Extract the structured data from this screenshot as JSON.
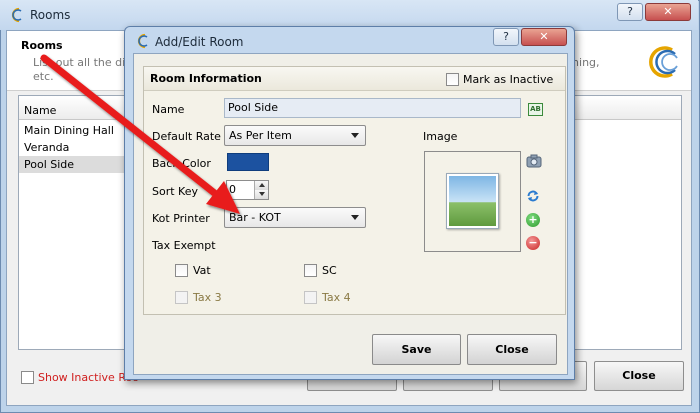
{
  "rooms_window": {
    "title": "Rooms",
    "heading": "Rooms",
    "description_line1": "List out all the dini",
    "description_line2": "etc.",
    "description_right": "ining,",
    "grid": {
      "column_name": "Name",
      "rows": [
        "Main Dining Hall",
        "Veranda",
        "Pool Side"
      ]
    },
    "show_inactive_label": "Show Inactive Roo",
    "close_label": "Close",
    "help_glyph": "?",
    "close_glyph": "✕"
  },
  "dialog": {
    "title": "Add/Edit Room",
    "help_glyph": "?",
    "close_glyph": "✕",
    "section_title": "Room Information",
    "mark_inactive_label": "Mark as Inactive",
    "name_label": "Name",
    "name_value": "Pool Side",
    "default_rate_label": "Default Rate",
    "default_rate_value": "As Per Item",
    "back_color_label": "Back Color",
    "sort_key_label": "Sort Key",
    "sort_key_value": "0",
    "kot_printer_label": "Kot Printer",
    "kot_printer_value": "Bar - KOT",
    "tax_exempt_label": "Tax Exempt",
    "tax_options": [
      {
        "label": "Vat",
        "enabled": true
      },
      {
        "label": "SC",
        "enabled": true
      },
      {
        "label": "Tax 3",
        "enabled": false
      },
      {
        "label": "Tax 4",
        "enabled": false
      }
    ],
    "image_label": "Image",
    "ab_icon_text": "AB",
    "save_label": "Save",
    "close_label": "Close",
    "back_color_value": "#1c52a0"
  },
  "annotation": {
    "color": "#e81c1c"
  }
}
